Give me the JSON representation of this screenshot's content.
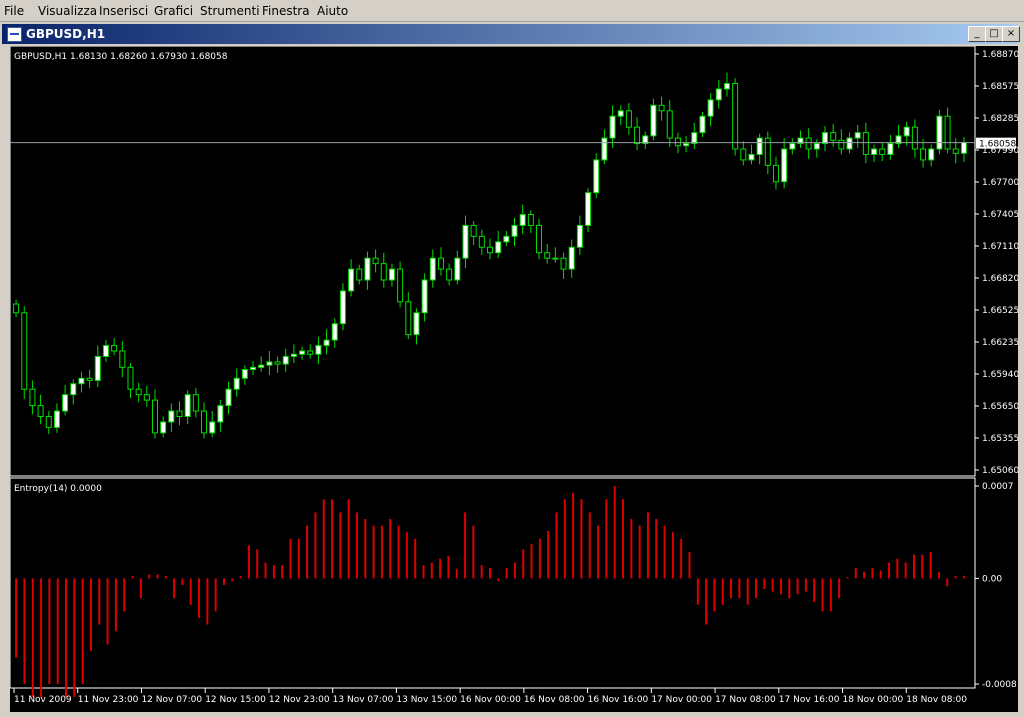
{
  "menu": [
    "File",
    "Visualizza",
    "Inserisci",
    "Grafici",
    "Strumenti",
    "Finestra",
    "Aiuto"
  ],
  "window": {
    "title": "GBPUSD,H1",
    "buttons": [
      "_",
      "□",
      "×"
    ]
  },
  "colors": {
    "bull": "#ffffff",
    "wick": "#00dd00",
    "bear": "#000000",
    "histogram": "#dd0000",
    "background": "#000000",
    "axisText": "#ffffff"
  },
  "chart_data": [
    {
      "type": "candlestick",
      "title": "GBPUSD,H1  1.68130 1.68260 1.67930 1.68058",
      "current_price": "1.68058",
      "y_ticks": [
        "1.68870",
        "1.68575",
        "1.68285",
        "1.67990",
        "1.67700",
        "1.67405",
        "1.67110",
        "1.66820",
        "1.66525",
        "1.66235",
        "1.65940",
        "1.65650",
        "1.65355",
        "1.65060"
      ],
      "ylim": [
        1.6506,
        1.6887
      ],
      "x_ticks": [
        "11 Nov 2009",
        "11 Nov 23:00",
        "12 Nov 07:00",
        "12 Nov 15:00",
        "12 Nov 23:00",
        "13 Nov 07:00",
        "13 Nov 15:00",
        "16 Nov 00:00",
        "16 Nov 08:00",
        "16 Nov 16:00",
        "17 Nov 00:00",
        "17 Nov 08:00",
        "17 Nov 16:00",
        "18 Nov 00:00",
        "18 Nov 08:00"
      ],
      "close": [
        1.665,
        1.658,
        1.6565,
        1.6555,
        1.6545,
        1.656,
        1.6575,
        1.6585,
        1.659,
        1.6588,
        1.661,
        1.662,
        1.6615,
        1.66,
        1.658,
        1.6575,
        1.657,
        1.654,
        1.655,
        1.656,
        1.6555,
        1.6575,
        1.656,
        1.654,
        1.655,
        1.6565,
        1.658,
        1.659,
        1.6598,
        1.66,
        1.6602,
        1.6605,
        1.6603,
        1.661,
        1.6612,
        1.6615,
        1.6612,
        1.662,
        1.6625,
        1.664,
        1.667,
        1.669,
        1.668,
        1.67,
        1.6695,
        1.668,
        1.669,
        1.666,
        1.663,
        1.665,
        1.668,
        1.67,
        1.669,
        1.668,
        1.67,
        1.673,
        1.672,
        1.671,
        1.6705,
        1.6715,
        1.672,
        1.673,
        1.674,
        1.673,
        1.6705,
        1.67,
        1.67,
        1.669,
        1.671,
        1.673,
        1.676,
        1.679,
        1.681,
        1.683,
        1.6835,
        1.682,
        1.6805,
        1.6812,
        1.684,
        1.6835,
        1.681,
        1.6803,
        1.6805,
        1.6815,
        1.683,
        1.6845,
        1.6855,
        1.686,
        1.68,
        1.679,
        1.6795,
        1.681,
        1.6785,
        1.677,
        1.68,
        1.6805,
        1.681,
        1.68,
        1.6805,
        1.6815,
        1.6808,
        1.68,
        1.681,
        1.6815,
        1.6795,
        1.68,
        1.6795,
        1.6805,
        1.6812,
        1.682,
        1.68,
        1.679,
        1.68,
        1.683,
        1.68,
        1.6796,
        1.6806
      ]
    },
    {
      "type": "bar",
      "title": "Entropy(14) 0.0000",
      "y_ticks": [
        "0.0007",
        "0.00",
        "-0.0008"
      ],
      "ylim": [
        -0.0008,
        0.0007
      ],
      "values": [
        -0.0006,
        -0.0008,
        -0.0009,
        -0.0009,
        -0.0008,
        -0.0008,
        -0.0009,
        -0.0009,
        -0.0008,
        -0.00055,
        -0.00035,
        -0.0005,
        -0.0004,
        -0.00025,
        2e-05,
        -0.00015,
        3e-05,
        3e-05,
        2e-05,
        -0.00015,
        -5e-05,
        -0.0002,
        -0.0003,
        -0.00035,
        -0.00025,
        -5e-05,
        -2e-05,
        2e-05,
        0.00025,
        0.00022,
        0.00012,
        0.0001,
        0.0001,
        0.0003,
        0.0003,
        0.0004,
        0.0005,
        0.0006,
        0.0006,
        0.0005,
        0.0006,
        0.0005,
        0.00045,
        0.0004,
        0.0004,
        0.00045,
        0.0004,
        0.00035,
        0.0003,
        0.0001,
        0.00012,
        0.00015,
        0.00017,
        7e-05,
        0.0005,
        0.0004,
        0.0001,
        8e-05,
        -2e-05,
        8e-05,
        0.00012,
        0.00022,
        0.00026,
        0.0003,
        0.00036,
        0.0005,
        0.0006,
        0.00065,
        0.0006,
        0.0005,
        0.0004,
        0.0006,
        0.0007,
        0.0006,
        0.00045,
        0.0004,
        0.0005,
        0.00045,
        0.0004,
        0.00035,
        0.0003,
        0.0002,
        -0.0002,
        -0.00035,
        -0.00025,
        -0.0002,
        -0.00015,
        -0.00015,
        -0.0002,
        -0.00015,
        -8e-05,
        -0.0001,
        -0.00012,
        -0.00015,
        -0.00012,
        -0.0001,
        -0.00018,
        -0.00025,
        -0.00025,
        -0.00015,
        1e-05,
        8e-05,
        5e-05,
        8e-05,
        6e-05,
        0.00012,
        0.00015,
        0.00012,
        0.00018,
        0.00018,
        0.0002,
        5e-05,
        -6e-05,
        2e-05,
        2e-05
      ]
    }
  ]
}
